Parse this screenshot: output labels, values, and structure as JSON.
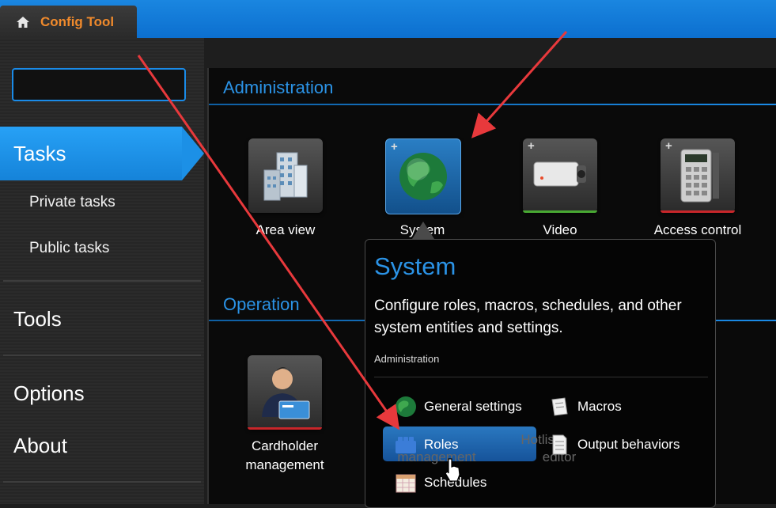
{
  "app": {
    "tab_title": "Config Tool",
    "home_icon": "home-icon"
  },
  "sidebar": {
    "search_value": "",
    "selected": "Tasks",
    "subitems": [
      "Private tasks",
      "Public tasks"
    ],
    "items": [
      "Tools",
      "Options",
      "About"
    ]
  },
  "sections": {
    "administration": "Administration",
    "operation": "Operation"
  },
  "tiles": {
    "administration": [
      {
        "label": "Area view",
        "icon": "buildings-icon",
        "accent": "#1a1a1a"
      },
      {
        "label": "System",
        "icon": "globe-icon",
        "accent": "#1e6fc0"
      },
      {
        "label": "Video",
        "icon": "camera-icon",
        "accent": "#48a832"
      },
      {
        "label": "Access control",
        "icon": "keypad-icon",
        "accent": "#c8262a"
      }
    ],
    "operation": [
      {
        "label_line1": "Cardholder",
        "label_line2": "management",
        "icon": "cardholder-icon",
        "accent": "#c8262a"
      }
    ],
    "ghost_tiles": [
      {
        "line1": "",
        "line2": "management"
      },
      {
        "line1": "Hotlist",
        "line2": "editor"
      }
    ]
  },
  "popup": {
    "title": "System",
    "description": "Configure roles, macros, schedules, and other system entities and settings.",
    "section": "Administration",
    "items": [
      {
        "label": "General settings",
        "icon": "globe-icon"
      },
      {
        "label": "Macros",
        "icon": "scroll-icon"
      },
      {
        "label": "Roles",
        "icon": "lego-block-icon",
        "highlighted": true
      },
      {
        "label": "Output behaviors",
        "icon": "document-icon"
      },
      {
        "label": "Schedules",
        "icon": "calendar-icon"
      }
    ]
  },
  "colors": {
    "accent": "#1a8be8",
    "brand_orange": "#f08a2c",
    "annotation_red": "#e8393c"
  }
}
